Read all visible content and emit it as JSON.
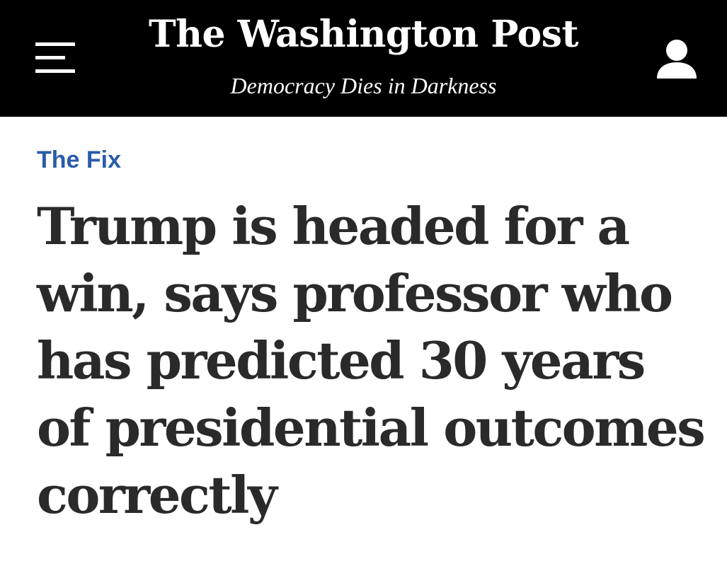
{
  "header": {
    "brand": "The Washington Post",
    "tagline": "Democracy Dies in Darkness",
    "menu_icon": "hamburger-menu-icon",
    "account_icon": "user-account-icon"
  },
  "article": {
    "section": "The Fix",
    "headline": "Trump is headed for a win, says professor who has predicted 30 years of presidential outcomes correctly"
  },
  "colors": {
    "header_bg": "#000000",
    "header_text": "#ffffff",
    "section_link": "#2a5caa",
    "headline_text": "#2a2a2a",
    "page_bg": "#ffffff"
  }
}
